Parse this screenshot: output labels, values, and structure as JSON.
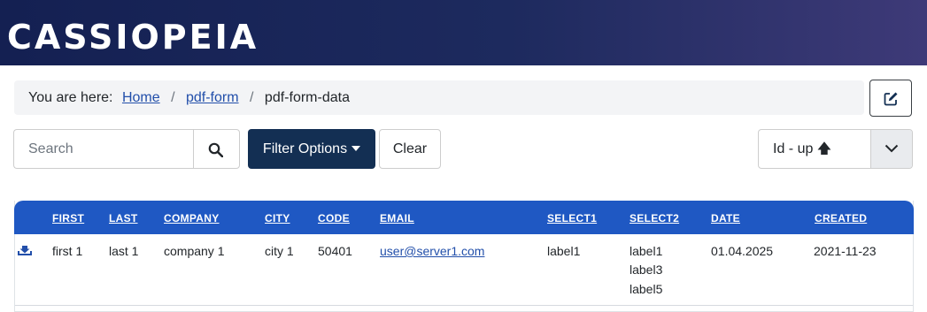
{
  "header": {
    "brand": "CASSIOPEIA"
  },
  "breadcrumb": {
    "prefix": "You are here:",
    "items": [
      "Home",
      "pdf-form",
      "pdf-form-data"
    ],
    "separator": "/"
  },
  "toolbar": {
    "search_placeholder": "Search",
    "filter_label": "Filter Options",
    "clear_label": "Clear",
    "sort_value": "Id - up 🡅"
  },
  "table": {
    "headers": [
      "First",
      "Last",
      "Company",
      "City",
      "Code",
      "Email",
      "Select1",
      "Select2",
      "Date",
      "Created"
    ],
    "rows": [
      {
        "first": "first 1",
        "last": "last 1",
        "company": "company 1",
        "city": "city 1",
        "code": "50401",
        "email": "user@server1.com",
        "select1": "label1",
        "select2": [
          "label1",
          "label3",
          "label5"
        ],
        "date": "01.04.2025",
        "created": "2021-11-23"
      }
    ]
  },
  "colors": {
    "header_start": "#142052",
    "header_end": "#3e3a78",
    "table_header": "#1f58c3",
    "filter_button": "#132f53",
    "link": "#224faa"
  },
  "icons": [
    "edit-icon",
    "search-icon",
    "caret-down-icon",
    "arrow-up-icon",
    "chevron-down-icon",
    "download-icon"
  ]
}
